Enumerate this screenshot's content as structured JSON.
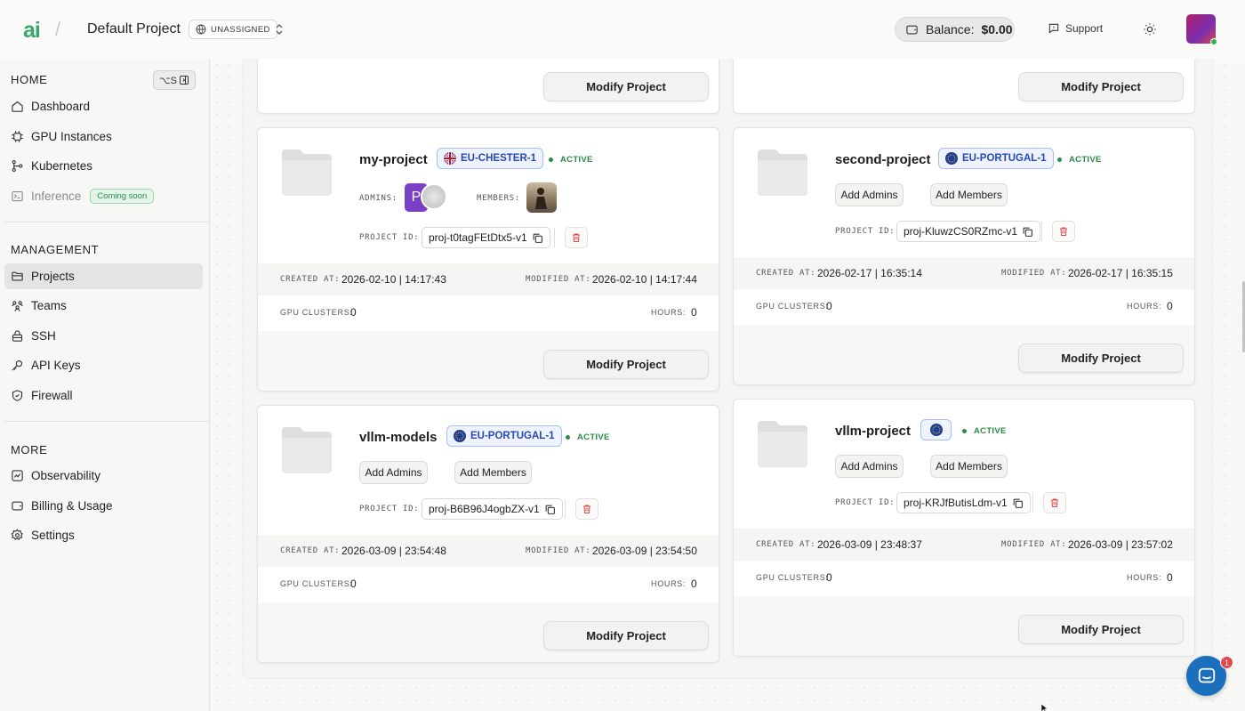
{
  "header": {
    "logo_text": "ai",
    "project_name": "Default Project",
    "region_selector": "UNASSIGNED",
    "balance_label": "Balance:",
    "balance_value": "$0.00",
    "support_label": "Support"
  },
  "sidebar": {
    "home_label": "HOME",
    "shortcut": "⌥S",
    "home_items": [
      {
        "label": "Dashboard",
        "icon": "home-icon"
      },
      {
        "label": "GPU Instances",
        "icon": "chip-icon"
      },
      {
        "label": "Kubernetes",
        "icon": "git-branch-icon"
      },
      {
        "label": "Inference",
        "icon": "terminal-icon",
        "badge": "Coming soon"
      }
    ],
    "management_label": "MANAGEMENT",
    "management_items": [
      {
        "label": "Projects",
        "icon": "folder-icon",
        "active": true
      },
      {
        "label": "Teams",
        "icon": "users-icon"
      },
      {
        "label": "SSH",
        "icon": "lock-icon"
      },
      {
        "label": "API Keys",
        "icon": "key-icon"
      },
      {
        "label": "Firewall",
        "icon": "shield-icon"
      }
    ],
    "more_label": "MORE",
    "more_items": [
      {
        "label": "Observability",
        "icon": "chart-icon"
      },
      {
        "label": "Billing & Usage",
        "icon": "wallet-icon"
      },
      {
        "label": "Settings",
        "icon": "gear-icon"
      }
    ]
  },
  "labels": {
    "modify": "Modify Project",
    "admins": "ADMINS:",
    "members": "MEMBERS:",
    "project_id": "PROJECT ID:",
    "created_at": "CREATED AT:",
    "modified_at": "MODIFIED AT:",
    "gpu_clusters": "GPU CLUSTERS:",
    "hours": "HOURS:",
    "add_admins": "Add Admins",
    "add_members": "Add Members"
  },
  "projects": [
    {
      "name": "my-project",
      "region": "EU-CHESTER-1",
      "flag": "uk",
      "status": "ACTIVE",
      "admin_initial": "P",
      "project_id": "proj-t0tagFEtDtx5-v1",
      "created_at": "2026-02-10 | 14:17:43",
      "modified_at": "2026-02-10 | 14:17:44",
      "gpu_clusters": "0",
      "hours": "0"
    },
    {
      "name": "second-project",
      "region": "EU-PORTUGAL-1",
      "flag": "eu",
      "status": "ACTIVE",
      "project_id": "proj-KluwzCS0RZmc-v1",
      "created_at": "2026-02-17 | 16:35:14",
      "modified_at": "2026-02-17 | 16:35:15",
      "gpu_clusters": "0",
      "hours": "0"
    },
    {
      "name": "vllm-models",
      "region": "EU-PORTUGAL-1",
      "flag": "eu",
      "status": "ACTIVE",
      "project_id": "proj-B6B96J4ogbZX-v1",
      "created_at": "2026-03-09 | 23:54:48",
      "modified_at": "2026-03-09 | 23:54:50",
      "gpu_clusters": "0",
      "hours": "0"
    },
    {
      "name": "vllm-project",
      "region": "",
      "flag": "eu",
      "status": "ACTIVE",
      "project_id": "proj-KRJfButisLdm-v1",
      "created_at": "2026-03-09 | 23:48:37",
      "modified_at": "2026-03-09 | 23:57:02",
      "gpu_clusters": "0",
      "hours": "0"
    }
  ],
  "chat": {
    "badge_count": "1"
  },
  "colors": {
    "accent_green": "#3aa56a",
    "region_blue": "#2748b8",
    "status_green": "#2b8a45",
    "danger_red": "#e0484c"
  }
}
